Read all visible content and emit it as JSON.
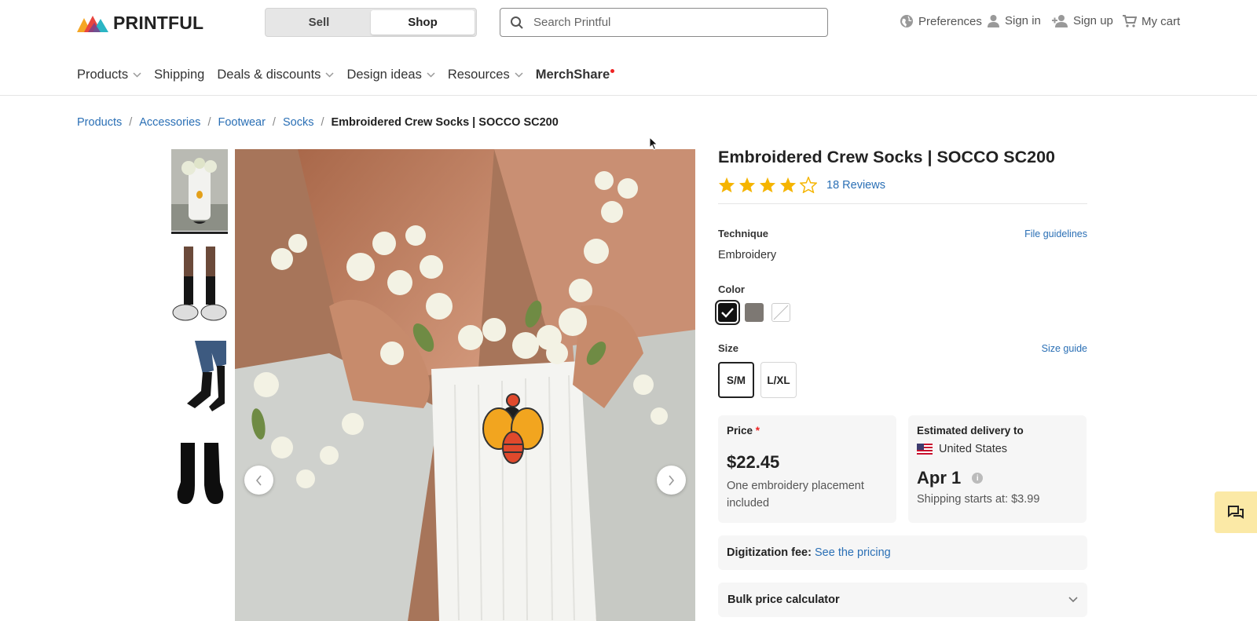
{
  "brand": {
    "name": "PRINTFUL"
  },
  "mode_toggle": {
    "sell": "Sell",
    "shop": "Shop"
  },
  "search": {
    "placeholder": "Search Printful"
  },
  "utility": {
    "preferences": "Preferences",
    "sign_in": "Sign in",
    "sign_up": "Sign up",
    "cart": "My cart"
  },
  "nav": {
    "items": [
      {
        "label": "Products",
        "dropdown": true
      },
      {
        "label": "Shipping",
        "dropdown": false
      },
      {
        "label": "Deals & discounts",
        "dropdown": true
      },
      {
        "label": "Design ideas",
        "dropdown": true
      },
      {
        "label": "Resources",
        "dropdown": true
      },
      {
        "label": "MerchShare",
        "dropdown": false
      }
    ]
  },
  "breadcrumb": [
    "Products",
    "Accessories",
    "Footwear",
    "Socks",
    "Embroidered Crew Socks | SOCCO SC200"
  ],
  "product": {
    "title": "Embroidered Crew Socks | SOCCO SC200",
    "rating": 4,
    "rating_max": 5,
    "reviews": "18 Reviews",
    "technique_label": "Technique",
    "file_guidelines": "File guidelines",
    "technique_value": "Embroidery",
    "color_label": "Color",
    "colors": [
      "#111111",
      "#7d7873",
      "#ffffff"
    ],
    "selected_color": 0,
    "size_label": "Size",
    "size_guide": "Size guide",
    "sizes": [
      "S/M",
      "L/XL"
    ],
    "selected_size": 0
  },
  "price_card": {
    "label": "Price",
    "required_mark": "*",
    "price": "$22.45",
    "note": "One embroidery placement included"
  },
  "delivery_card": {
    "label": "Estimated delivery to",
    "country": "United States",
    "date": "Apr 1",
    "info": "i",
    "shipping": "Shipping starts at: $3.99"
  },
  "digitization": {
    "label": "Digitization fee:",
    "link": "See the pricing"
  },
  "bulk": {
    "label": "Bulk price calculator"
  },
  "colors_ui": {
    "accent_link": "#2a6fb5",
    "star": "#f5b400",
    "chat_bg": "#fbe9a6"
  }
}
